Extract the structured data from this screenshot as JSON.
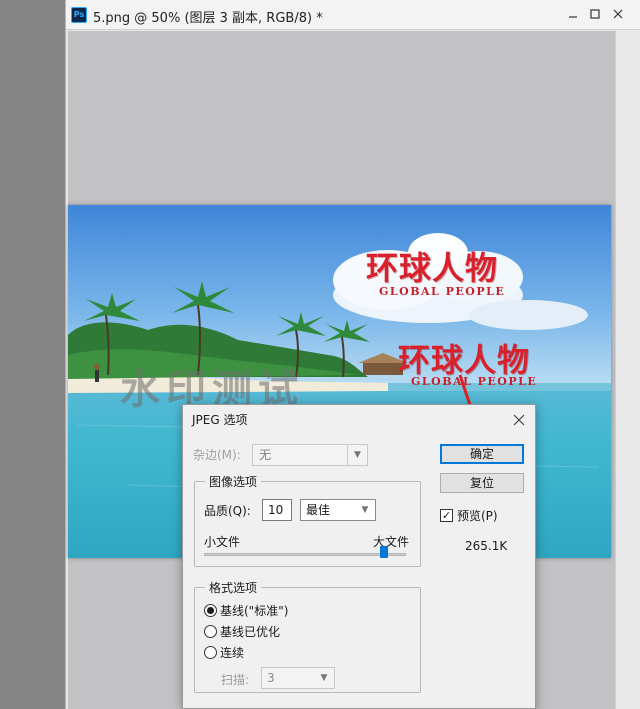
{
  "window": {
    "app_icon": "Ps",
    "title": "5.png @ 50% (图层 3 副本, RGB/8) *",
    "controls": [
      "minimize-icon",
      "maximize-icon",
      "close-icon"
    ]
  },
  "image": {
    "watermark_text": "水印测试",
    "brand_upper": {
      "title": "环球人物",
      "subtitle": "GLOBAL PEOPLE"
    },
    "brand_lower": {
      "title": "环球人物",
      "subtitle": "GLOBAL PEOPLE"
    }
  },
  "dialog": {
    "title": "JPEG 选项",
    "matte_label": "杂边(M):",
    "matte_value": "无",
    "image_options": {
      "group_label": "图像选项",
      "quality_label": "品质(Q):",
      "quality_value": "10",
      "quality_preset": "最佳",
      "small_file_label": "小文件",
      "large_file_label": "大文件",
      "slider_level": 1.0
    },
    "format_options": {
      "group_label": "格式选项",
      "options": [
        "基线(\"标准\")",
        "基线已优化",
        "连续"
      ],
      "selected_index": 0,
      "scan_label": "扫描:",
      "scan_value": "3"
    },
    "ok_button": "确定",
    "reset_button": "复位",
    "preview_label": "预览(P)",
    "preview_checked": true,
    "file_size": "265.1K"
  },
  "colors": {
    "accent": "#0078d7",
    "brand_red": "#d8212c",
    "arrow_red": "#e02020"
  }
}
